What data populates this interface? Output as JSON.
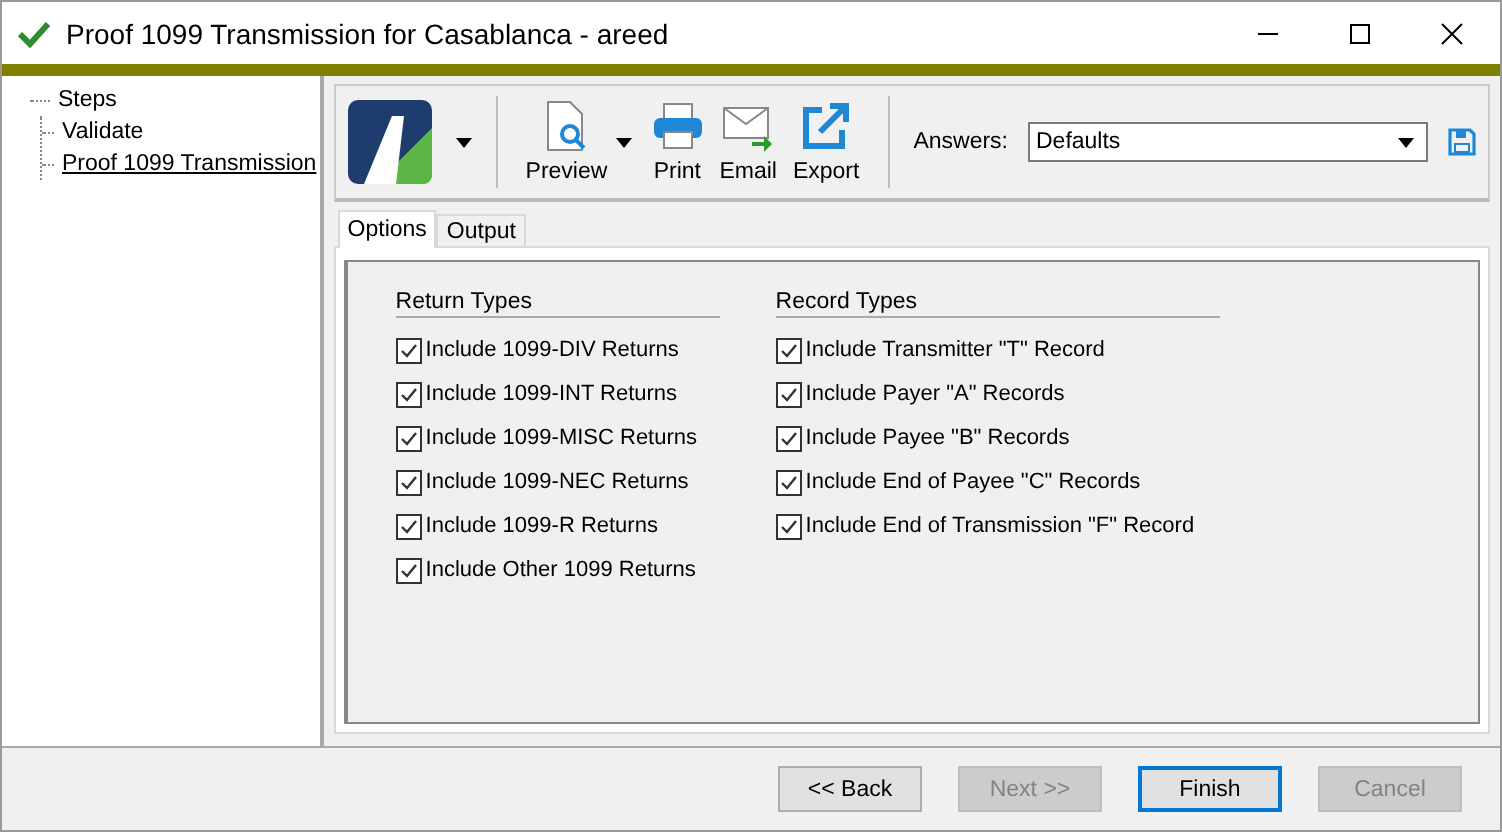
{
  "window": {
    "title": "Proof 1099 Transmission for Casablanca - areed"
  },
  "tree": {
    "label": "Steps",
    "children": [
      {
        "label": "Validate",
        "selected": false
      },
      {
        "label": "Proof 1099 Transmission",
        "selected": true
      }
    ]
  },
  "toolbar": [
    {
      "kind": "preview",
      "label": "Preview",
      "dropdown": true
    },
    {
      "kind": "print",
      "label": "Print",
      "dropdown": false
    },
    {
      "kind": "email",
      "label": "Email",
      "dropdown": false
    },
    {
      "kind": "export",
      "label": "Export",
      "dropdown": false
    }
  ],
  "answers": {
    "label": "Answers:",
    "value": "Defaults"
  },
  "tabs": [
    {
      "label": "Options",
      "selected": true
    },
    {
      "label": "Output",
      "selected": false
    }
  ],
  "groups": [
    {
      "title": "Return Types",
      "options": [
        {
          "label": "Include 1099-DIV Returns",
          "checked": true
        },
        {
          "label": "Include 1099-INT Returns",
          "checked": true
        },
        {
          "label": "Include 1099-MISC Returns",
          "checked": true
        },
        {
          "label": "Include 1099-NEC Returns",
          "checked": true
        },
        {
          "label": "Include 1099-R Returns",
          "checked": true
        },
        {
          "label": "Include Other 1099 Returns",
          "checked": true
        }
      ]
    },
    {
      "title": "Record Types",
      "options": [
        {
          "label": "Include Transmitter \"T\" Record",
          "checked": true
        },
        {
          "label": "Include Payer \"A\" Records",
          "checked": true
        },
        {
          "label": "Include Payee \"B\" Records",
          "checked": true
        },
        {
          "label": "Include End of Payee \"C\" Records",
          "checked": true
        },
        {
          "label": "Include End of Transmission \"F\" Record",
          "checked": true
        }
      ]
    }
  ],
  "buttons": [
    {
      "label": "<< Back",
      "disabled": false,
      "default": false
    },
    {
      "label": "Next >>",
      "disabled": true,
      "default": false
    },
    {
      "label": "Finish",
      "disabled": false,
      "default": true
    },
    {
      "label": "Cancel",
      "disabled": true,
      "default": false
    }
  ]
}
